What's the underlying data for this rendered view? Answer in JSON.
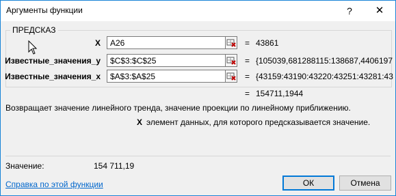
{
  "window": {
    "title": "Аргументы функции",
    "help_glyph": "?",
    "close_glyph": "✕"
  },
  "function": {
    "name": "ПРЕДСКАЗ",
    "args": [
      {
        "label": "X",
        "value": "A26",
        "result": "43861"
      },
      {
        "label": "Известные_значения_y",
        "value": "$C$3:$C$25",
        "result": "{105039,681288115:138687,4406197"
      },
      {
        "label": "Известные_значения_x",
        "value": "$A$3:$A$25",
        "result": "{43159:43190:43220:43251:43281:43"
      }
    ],
    "equals": "=",
    "formula_result": "154711,1944",
    "description": "Возвращает значение линейного тренда, значение проекции по линейному приближению.",
    "arg_help_name": "X",
    "arg_help_text": "элемент данных, для которого предсказывается значение."
  },
  "footer": {
    "value_label": "Значение:",
    "value": "154 711,19",
    "help_link": "Справка по этой функции",
    "ok_label": "ОК",
    "cancel_label": "Отмена"
  },
  "colors": {
    "accent": "#0078d7",
    "link": "#0066cc",
    "dialog_bg": "#f0f0f0"
  }
}
